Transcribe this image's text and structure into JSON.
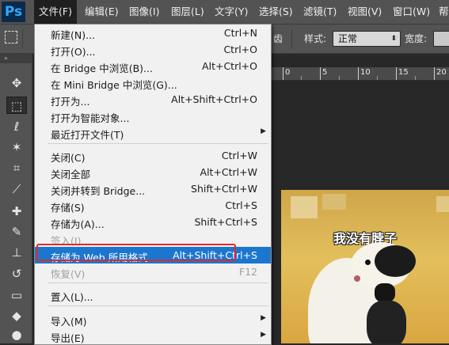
{
  "app": {
    "logo": "Ps"
  },
  "menubar": {
    "items": [
      {
        "label": "文件(F)"
      },
      {
        "label": "编辑(E)"
      },
      {
        "label": "图像(I)"
      },
      {
        "label": "图层(L)"
      },
      {
        "label": "文字(Y)"
      },
      {
        "label": "选择(S)"
      },
      {
        "label": "滤镜(T)"
      },
      {
        "label": "视图(V)"
      },
      {
        "label": "窗口(W)"
      },
      {
        "label": "帮"
      }
    ]
  },
  "options": {
    "partial_label": "齿",
    "style_label": "样式:",
    "style_value": "正常",
    "width_label": "宽度:"
  },
  "ruler": {
    "numbers": [
      "0",
      "5",
      "10",
      "15",
      "20"
    ]
  },
  "toolbar": {
    "grip": "»",
    "tools": [
      {
        "name": "move-tool",
        "glyph": "✥"
      },
      {
        "name": "marquee-tool",
        "glyph": "⬚"
      },
      {
        "name": "lasso-tool",
        "glyph": "ℓ"
      },
      {
        "name": "magic-wand-tool",
        "glyph": "✶"
      },
      {
        "name": "crop-tool",
        "glyph": "⌗"
      },
      {
        "name": "eyedropper-tool",
        "glyph": "⟋"
      },
      {
        "name": "healing-brush-tool",
        "glyph": "✚"
      },
      {
        "name": "brush-tool",
        "glyph": "✎"
      },
      {
        "name": "clone-stamp-tool",
        "glyph": "⊥"
      },
      {
        "name": "history-brush-tool",
        "glyph": "↺"
      },
      {
        "name": "eraser-tool",
        "glyph": "▭"
      },
      {
        "name": "paint-bucket-tool",
        "glyph": "◆"
      },
      {
        "name": "blur-tool",
        "glyph": "●"
      }
    ]
  },
  "document": {
    "caption": "我没有脖子"
  },
  "file_menu": {
    "items": [
      {
        "label": "新建(N)...",
        "shortcut": "Ctrl+N"
      },
      {
        "label": "打开(O)...",
        "shortcut": "Ctrl+O"
      },
      {
        "label": "在 Bridge 中浏览(B)...",
        "shortcut": "Alt+Ctrl+O"
      },
      {
        "label": "在 Mini Bridge 中浏览(G)...",
        "shortcut": ""
      },
      {
        "label": "打开为...",
        "shortcut": "Alt+Shift+Ctrl+O"
      },
      {
        "label": "打开为智能对象...",
        "shortcut": ""
      },
      {
        "label": "最近打开文件(T)",
        "shortcut": ""
      },
      {
        "label": "关闭(C)",
        "shortcut": "Ctrl+W"
      },
      {
        "label": "关闭全部",
        "shortcut": "Alt+Ctrl+W"
      },
      {
        "label": "关闭并转到 Bridge...",
        "shortcut": "Shift+Ctrl+W"
      },
      {
        "label": "存储(S)",
        "shortcut": "Ctrl+S"
      },
      {
        "label": "存储为(A)...",
        "shortcut": "Shift+Ctrl+S"
      },
      {
        "label": "签入(I)...",
        "shortcut": ""
      },
      {
        "label": "存储为 Web 所用格式...",
        "shortcut": "Alt+Shift+Ctrl+S"
      },
      {
        "label": "恢复(V)",
        "shortcut": "F12"
      },
      {
        "label": "置入(L)...",
        "shortcut": ""
      },
      {
        "label": "导入(M)",
        "shortcut": ""
      },
      {
        "label": "导出(E)",
        "shortcut": ""
      }
    ]
  },
  "colors": {
    "highlight": "#1b76d0",
    "annotation_box": "#e02a2a",
    "menubar_bg": "#535353",
    "workspace_bg": "#282828"
  }
}
